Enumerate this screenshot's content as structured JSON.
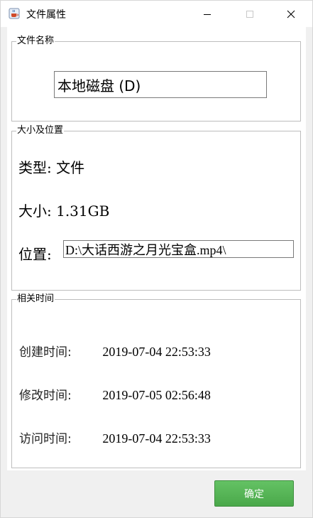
{
  "window": {
    "title": "文件属性"
  },
  "name_group": {
    "legend": "文件名称",
    "value": "本地磁盘 (D)"
  },
  "size_group": {
    "legend": "大小及位置",
    "type_line": "类型: 文件",
    "size_line": "大小: 1.31GB",
    "position_label": "位置:",
    "position_value": "D:\\大话西游之月光宝盒.mp4\\"
  },
  "time_group": {
    "legend": "相关时间",
    "rows": [
      {
        "label": "创建时间:",
        "value": "2019-07-04 22:53:33"
      },
      {
        "label": "修改时间:",
        "value": "2019-07-05 02:56:48"
      },
      {
        "label": "访问时间:",
        "value": "2019-07-04 22:53:33"
      }
    ]
  },
  "buttons": {
    "ok_label": "确定"
  },
  "colors": {
    "ok_button": "#4fae4f",
    "border": "#bdbdbd"
  },
  "icons": {
    "app": "java-cup-icon",
    "minimize": "minimize-icon",
    "maximize": "maximize-icon",
    "close": "close-icon"
  }
}
